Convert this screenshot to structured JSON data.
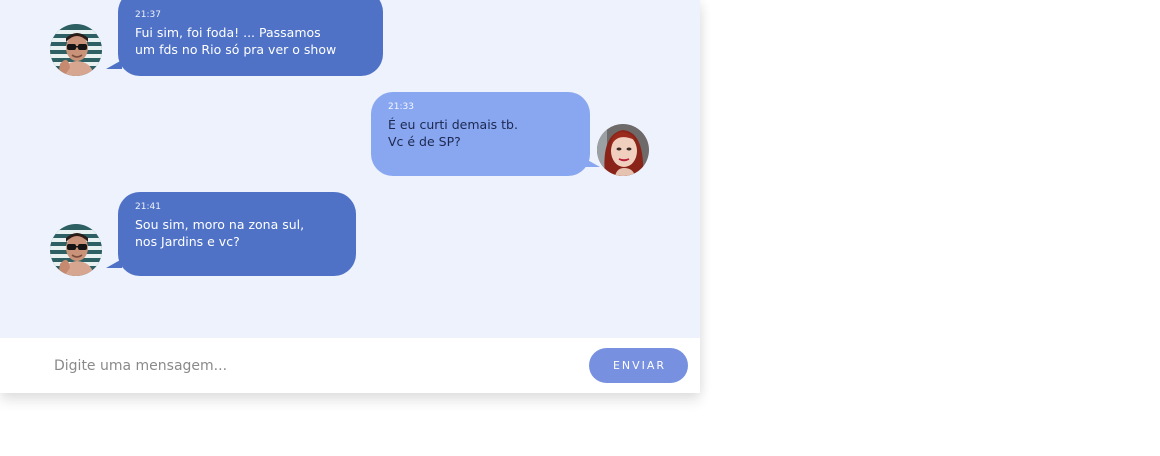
{
  "messages": [
    {
      "time": "21:37",
      "text": "Fui sim, foi foda! ... Passamos\num fds no Rio só pra ver o show",
      "direction": "received"
    },
    {
      "time": "21:33",
      "text": "É eu curti demais tb.\nVc é de SP?",
      "direction": "sent"
    },
    {
      "time": "21:41",
      "text": "Sou sim, moro na zona sul,\nnos Jardins e vc?",
      "direction": "received"
    }
  ],
  "composer": {
    "placeholder": "Digite uma mensagem...",
    "send_label": "ENVIAR"
  },
  "colors": {
    "background": "#eef2fd",
    "received_bubble": "#4f72c6",
    "sent_bubble": "#89a7f0",
    "send_button": "#7790e0"
  },
  "icons": {
    "contact_avatar": "avatar-man-sunglasses",
    "user_avatar": "avatar-woman-red-hair"
  }
}
